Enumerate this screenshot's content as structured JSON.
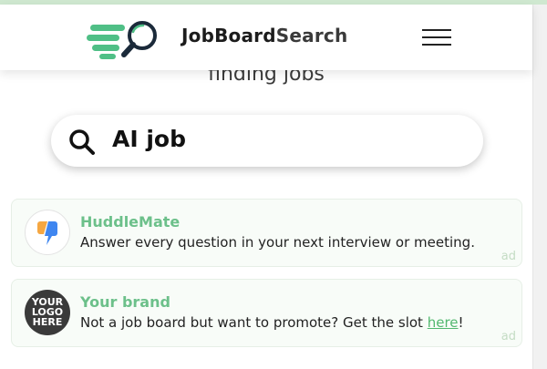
{
  "header": {
    "brand_bold": "JobBoard",
    "brand_rest": "Search",
    "logo_icon": "magnifier-speed-logo-icon",
    "menu_icon": "hamburger-menu-icon"
  },
  "hero": {
    "subtitle": "finding jobs"
  },
  "search": {
    "value": "AI job",
    "icon": "search-icon"
  },
  "ads": [
    {
      "title": "HuddleMate",
      "description": "Answer every question in your next interview or meeting.",
      "badge": "ad",
      "logo": "huddlemate-logo-icon"
    },
    {
      "title": "Your brand",
      "description_prefix": "Not a job board but want to promote? Get the slot ",
      "link_text": "here",
      "description_suffix": "!",
      "badge": "ad",
      "logo_lines": [
        "YOUR",
        "LOGO",
        "HERE"
      ]
    }
  ],
  "colors": {
    "accent": "#6cc08a",
    "logo_green": "#4fbf86",
    "logo_dark": "#1b2a3a"
  }
}
